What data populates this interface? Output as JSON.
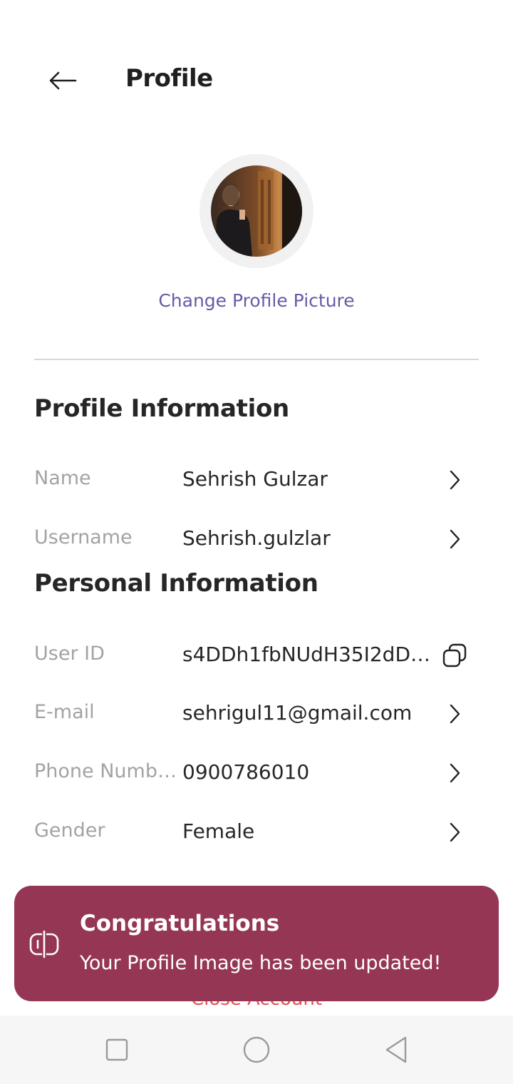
{
  "header": {
    "title": "Profile"
  },
  "avatar": {
    "change_label": "Change Profile Picture"
  },
  "profile_section": {
    "title": "Profile Information",
    "rows": [
      {
        "label": "Name",
        "value": "Sehrish Gulzar",
        "action_icon": "chevron-right-icon"
      },
      {
        "label": "Username",
        "value": "Sehrish.gulzlar",
        "action_icon": "chevron-right-icon"
      }
    ]
  },
  "personal_section": {
    "title": "Personal Information",
    "rows": [
      {
        "label": "User ID",
        "value": "s4DDh1fbNUdH35I2dD8…",
        "action_icon": "copy-icon"
      },
      {
        "label": "E-mail",
        "value": "sehrigul11@gmail.com",
        "action_icon": "chevron-right-icon"
      },
      {
        "label": "Phone Numb…",
        "value": "0900786010",
        "action_icon": "chevron-right-icon"
      },
      {
        "label": "Gender",
        "value": "Female",
        "action_icon": "chevron-right-icon"
      }
    ]
  },
  "close_account_label": "Close Account",
  "toast": {
    "title": "Congratulations",
    "message": "Your Profile Image has been updated!",
    "icon": "toast-status-icon",
    "background": "#953654"
  },
  "navbar": {
    "icons": [
      "recents-square-icon",
      "home-circle-icon",
      "back-triangle-icon"
    ]
  },
  "colors": {
    "accent": "#6a59a8",
    "danger": "#e85050",
    "label": "#a3a3a3"
  }
}
